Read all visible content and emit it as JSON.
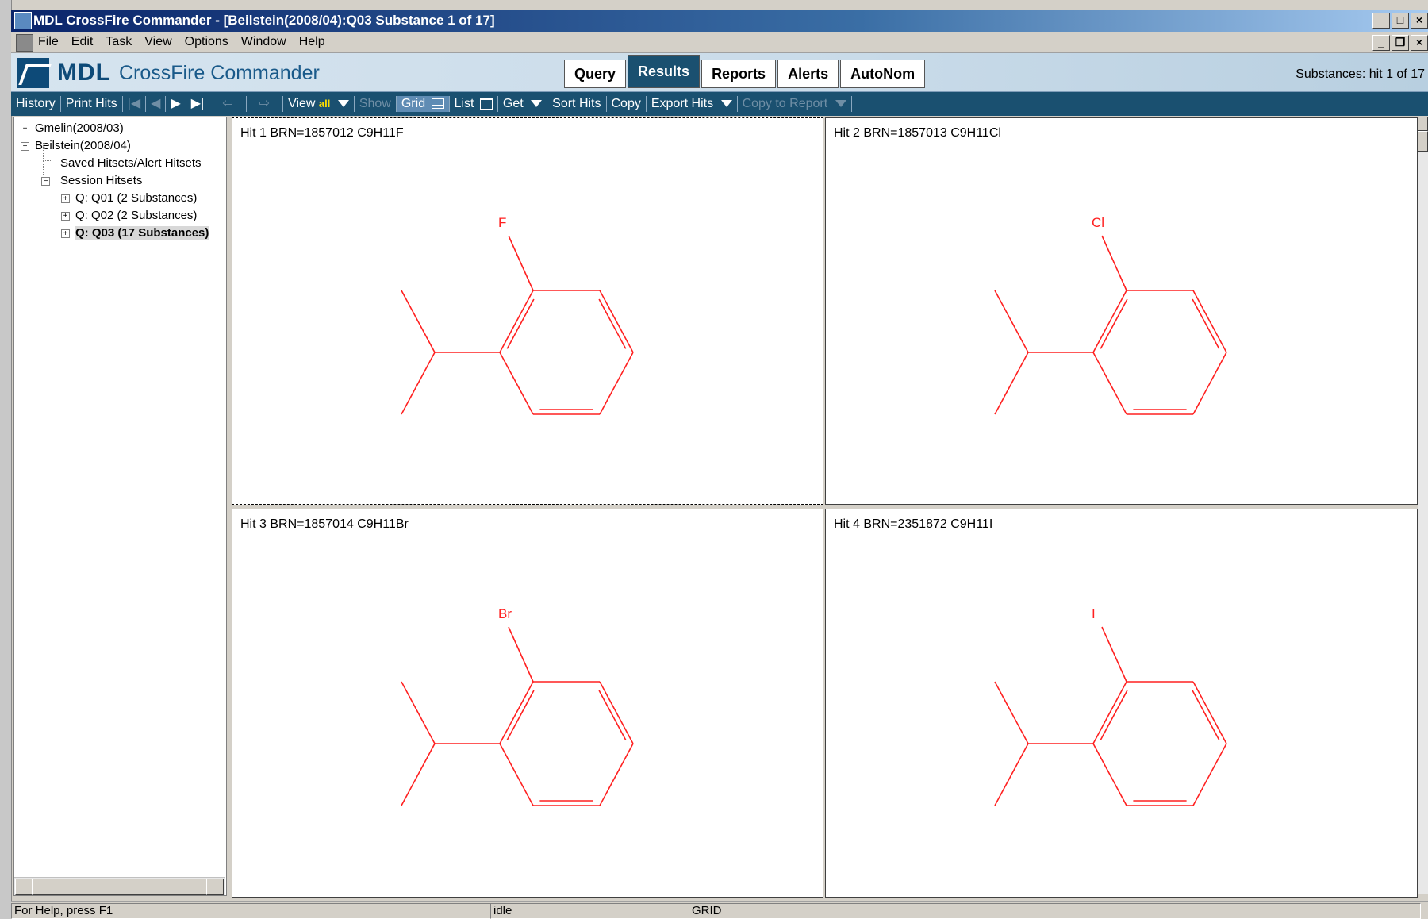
{
  "window": {
    "title": "MDL CrossFire Commander - [Beilstein(2008/04):Q03 Substance 1 of 17]",
    "min_glyph": "_",
    "max_glyph": "□",
    "close_glyph": "×",
    "restore_glyph": "❐"
  },
  "menu": [
    "File",
    "Edit",
    "Task",
    "View",
    "Options",
    "Window",
    "Help"
  ],
  "banner": {
    "logo_mdl": "MDL",
    "logo_product": "CrossFire Commander",
    "tabs": [
      {
        "label": "Query",
        "active": false
      },
      {
        "label": "Results",
        "active": true
      },
      {
        "label": "Reports",
        "active": false
      },
      {
        "label": "Alerts",
        "active": false
      },
      {
        "label": "AutoNom",
        "active": false
      }
    ],
    "substances_count": "Substances: hit 1 of 17"
  },
  "toolbar": {
    "history": "History",
    "print_hits": "Print Hits",
    "nav_first": "|◀",
    "nav_prev": "◀",
    "nav_next": "▶",
    "nav_last": "▶|",
    "back": "⇦",
    "forward": "⇨",
    "view": "View",
    "view_value": "all",
    "show": "Show",
    "grid": "Grid",
    "list": "List",
    "get": "Get",
    "sort_hits": "Sort Hits",
    "copy": "Copy",
    "export_hits": "Export Hits",
    "copy_to_report": "Copy to Report"
  },
  "tree": {
    "items": [
      {
        "label": "Gmelin(2008/03)",
        "expander": "+"
      },
      {
        "label": "Beilstein(2008/04)",
        "expander": "−"
      },
      {
        "label": "Saved Hitsets/Alert Hitsets",
        "expander": ""
      },
      {
        "label": "Session Hitsets",
        "expander": "−"
      },
      {
        "label": "Q: Q01 (2 Substances)",
        "expander": "+"
      },
      {
        "label": "Q: Q02 (2 Substances)",
        "expander": "+"
      },
      {
        "label": "Q: Q03 (17 Substances)",
        "expander": "+",
        "selected": true
      }
    ]
  },
  "hits": [
    {
      "title": "Hit 1 BRN=1857012 C9H11F",
      "halogen": "F"
    },
    {
      "title": "Hit 2 BRN=1857013 C9H11Cl",
      "halogen": "Cl"
    },
    {
      "title": "Hit 3 BRN=1857014 C9H11Br",
      "halogen": "Br"
    },
    {
      "title": "Hit 4 BRN=2351872 C9H11I",
      "halogen": "I"
    }
  ],
  "colors": {
    "structure": "#ff2020",
    "toolbar_bg": "#1a5070"
  },
  "status": {
    "help": "For Help, press F1",
    "state": "idle",
    "mode": "GRID"
  }
}
